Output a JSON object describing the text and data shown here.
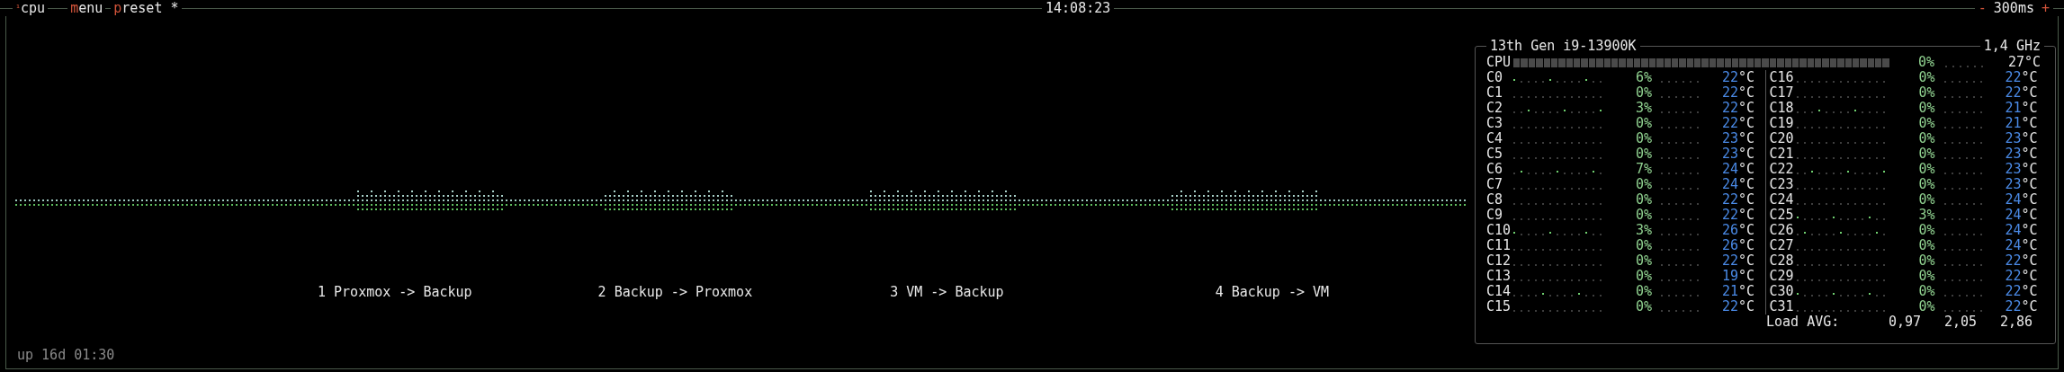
{
  "header": {
    "tabs": [
      {
        "hotkey": "¹",
        "label": "cpu"
      },
      {
        "hotkey": "m",
        "label": "enu"
      },
      {
        "hotkey": "p",
        "label": "reset *"
      }
    ],
    "clock": "14:08:23",
    "interval": {
      "minus": "-",
      "value": "300ms",
      "plus": "+"
    }
  },
  "graph": {
    "annotations": [
      "1 Proxmox -> Backup",
      "2 Backup -> Proxmox",
      "3 VM -> Backup",
      "4 Backup -> VM"
    ]
  },
  "uptime": "up 16d 01:30",
  "cpu_panel": {
    "model": "13th Gen i9-13900K",
    "frequency": "1,4 GHz",
    "total": {
      "name": "CPU",
      "level": 0,
      "percent": "0%",
      "temp": "27",
      "unit": "°C"
    },
    "cores": [
      {
        "name": "C0",
        "percent": "6%",
        "temp": "22",
        "unit": "°C"
      },
      {
        "name": "C1",
        "percent": "0%",
        "temp": "22",
        "unit": "°C"
      },
      {
        "name": "C2",
        "percent": "3%",
        "temp": "22",
        "unit": "°C"
      },
      {
        "name": "C3",
        "percent": "0%",
        "temp": "22",
        "unit": "°C"
      },
      {
        "name": "C4",
        "percent": "0%",
        "temp": "23",
        "unit": "°C"
      },
      {
        "name": "C5",
        "percent": "0%",
        "temp": "23",
        "unit": "°C"
      },
      {
        "name": "C6",
        "percent": "7%",
        "temp": "24",
        "unit": "°C"
      },
      {
        "name": "C7",
        "percent": "0%",
        "temp": "24",
        "unit": "°C"
      },
      {
        "name": "C8",
        "percent": "0%",
        "temp": "22",
        "unit": "°C"
      },
      {
        "name": "C9",
        "percent": "0%",
        "temp": "22",
        "unit": "°C"
      },
      {
        "name": "C10",
        "percent": "3%",
        "temp": "26",
        "unit": "°C"
      },
      {
        "name": "C11",
        "percent": "0%",
        "temp": "26",
        "unit": "°C"
      },
      {
        "name": "C12",
        "percent": "0%",
        "temp": "22",
        "unit": "°C"
      },
      {
        "name": "C13",
        "percent": "0%",
        "temp": "19",
        "unit": "°C"
      },
      {
        "name": "C14",
        "percent": "0%",
        "temp": "21",
        "unit": "°C"
      },
      {
        "name": "C15",
        "percent": "0%",
        "temp": "22",
        "unit": "°C"
      },
      {
        "name": "C16",
        "percent": "0%",
        "temp": "22",
        "unit": "°C"
      },
      {
        "name": "C17",
        "percent": "0%",
        "temp": "22",
        "unit": "°C"
      },
      {
        "name": "C18",
        "percent": "0%",
        "temp": "21",
        "unit": "°C"
      },
      {
        "name": "C19",
        "percent": "0%",
        "temp": "21",
        "unit": "°C"
      },
      {
        "name": "C20",
        "percent": "0%",
        "temp": "23",
        "unit": "°C"
      },
      {
        "name": "C21",
        "percent": "0%",
        "temp": "23",
        "unit": "°C"
      },
      {
        "name": "C22",
        "percent": "0%",
        "temp": "23",
        "unit": "°C"
      },
      {
        "name": "C23",
        "percent": "0%",
        "temp": "23",
        "unit": "°C"
      },
      {
        "name": "C24",
        "percent": "0%",
        "temp": "24",
        "unit": "°C"
      },
      {
        "name": "C25",
        "percent": "3%",
        "temp": "24",
        "unit": "°C"
      },
      {
        "name": "C26",
        "percent": "0%",
        "temp": "24",
        "unit": "°C"
      },
      {
        "name": "C27",
        "percent": "0%",
        "temp": "24",
        "unit": "°C"
      },
      {
        "name": "C28",
        "percent": "0%",
        "temp": "22",
        "unit": "°C"
      },
      {
        "name": "C29",
        "percent": "0%",
        "temp": "22",
        "unit": "°C"
      },
      {
        "name": "C30",
        "percent": "0%",
        "temp": "22",
        "unit": "°C"
      },
      {
        "name": "C31",
        "percent": "0%",
        "temp": "22",
        "unit": "°C"
      }
    ],
    "load": {
      "label": "Load AVG:",
      "values": [
        "0,97",
        "2,05",
        "2,86"
      ]
    }
  }
}
